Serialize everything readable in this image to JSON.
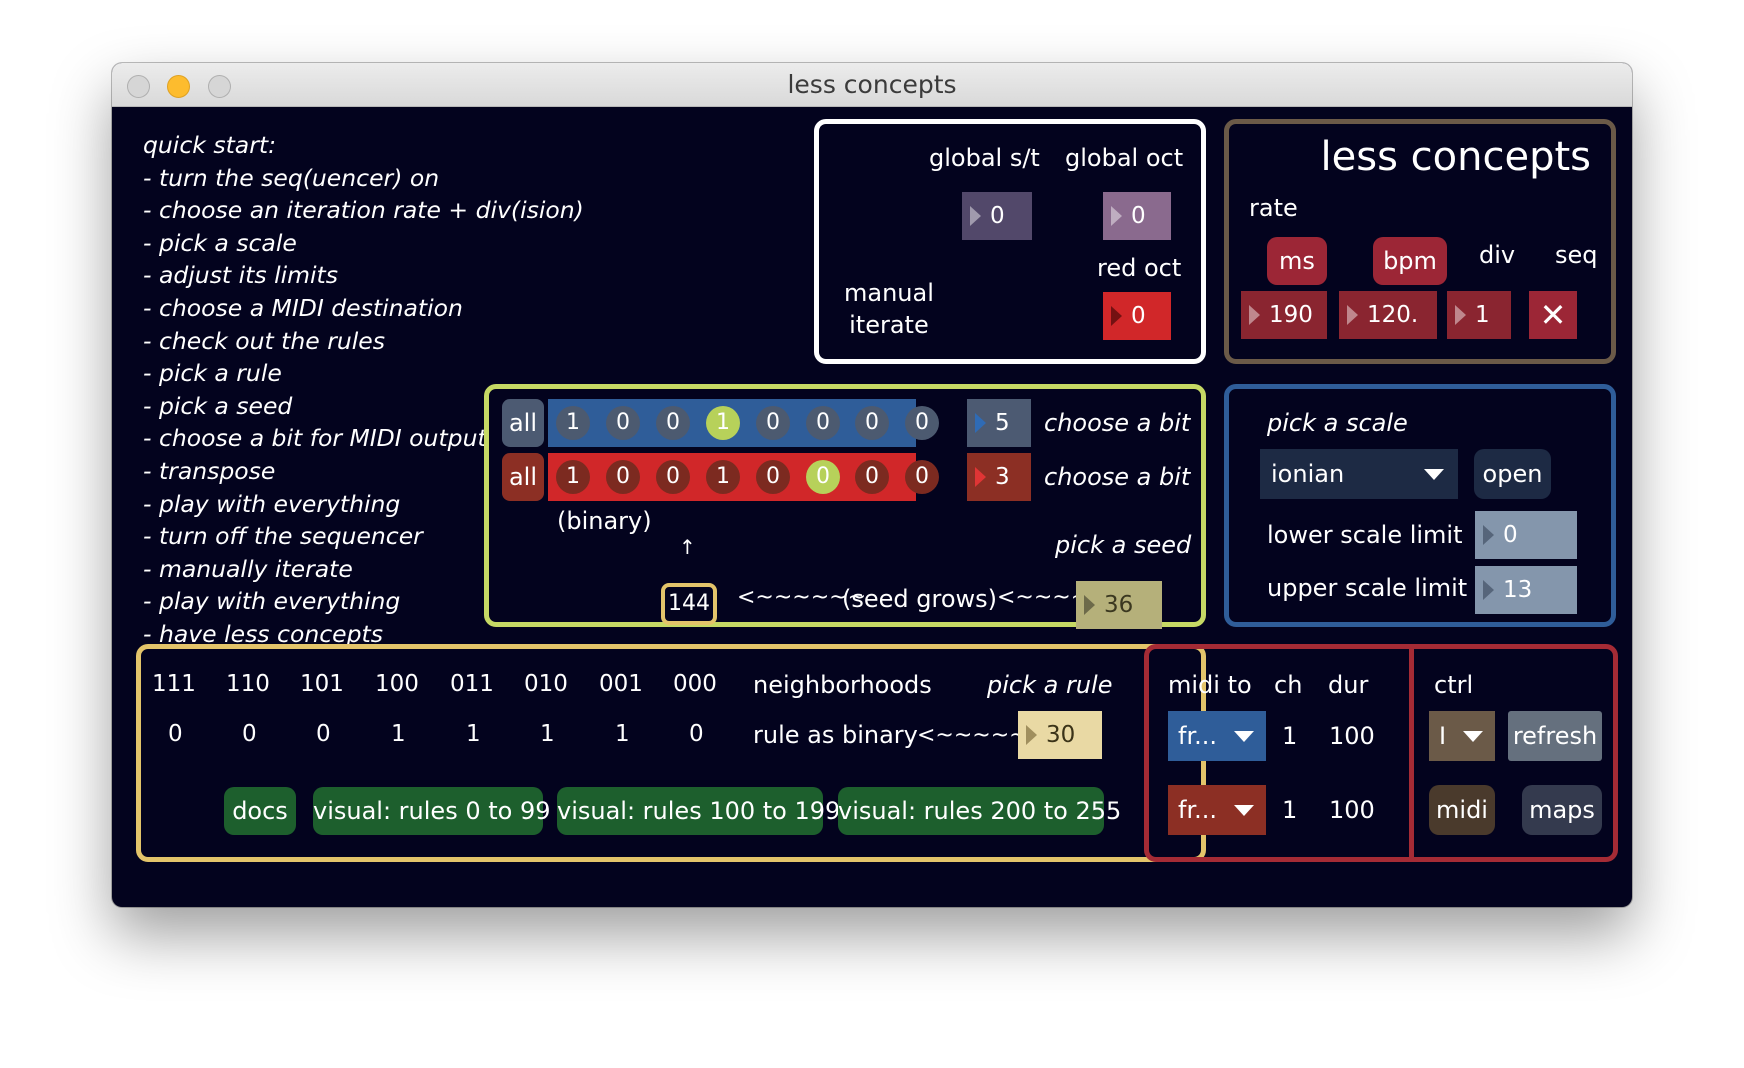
{
  "window": {
    "title": "less concepts"
  },
  "quick_start": {
    "title": "quick start:",
    "steps": [
      "- turn the seq(uencer) on",
      "- choose an iteration rate + div(ision)",
      "- pick a scale",
      "- adjust its limits",
      "- choose a MIDI destination",
      "- check out the rules",
      "- pick a rule",
      "- pick a seed",
      "- choose a bit for MIDI output",
      "- transpose",
      "- play with everything",
      "- turn off the sequencer",
      "- manually iterate",
      "- play with everything",
      "- have less concepts"
    ]
  },
  "global": {
    "st_label": "global s/t",
    "st_value": "0",
    "oct_label": "global oct",
    "oct_value": "0",
    "red_oct_label": "red oct",
    "red_oct_value": "0",
    "manual_iterate_line1": "manual",
    "manual_iterate_line2": "iterate"
  },
  "header": {
    "title": "less concepts",
    "rate_label": "rate",
    "ms_button": "ms",
    "bpm_button": "bpm",
    "div_label": "div",
    "seq_label": "seq",
    "ms_value": "190",
    "bpm_value": "120.",
    "div_value": "1",
    "seq_toggle": "✕"
  },
  "bits": {
    "all_label": "all",
    "blue_row": [
      "1",
      "0",
      "0",
      "1",
      "0",
      "0",
      "0",
      "0"
    ],
    "blue_selected_index": 3,
    "blue_value": "5",
    "red_row": [
      "1",
      "0",
      "0",
      "1",
      "0",
      "0",
      "0",
      "0"
    ],
    "red_selected_index": 5,
    "red_value": "3",
    "choose_bit_label": "choose a bit",
    "binary_label": "(binary)",
    "arrow": "↑",
    "pick_seed_label": "pick a seed",
    "seed_result": "144",
    "arrow_left_1": "<~~~~~~",
    "seed_grows_label": "(seed grows)",
    "arrow_left_2": "<~~~~~~",
    "seed_value": "36"
  },
  "scale": {
    "pick_label": "pick a scale",
    "selected": "ionian",
    "open_button": "open",
    "lower_label": "lower scale limit",
    "lower_value": "0",
    "upper_label": "upper scale limit",
    "upper_value": "13"
  },
  "rules": {
    "neighborhoods": [
      "111",
      "110",
      "101",
      "100",
      "011",
      "010",
      "001",
      "000"
    ],
    "neighborhoods_label": "neighborhoods",
    "pick_rule_label": "pick a rule",
    "binary_values": [
      "0",
      "0",
      "0",
      "1",
      "1",
      "1",
      "1",
      "0"
    ],
    "rule_as_binary_label": "rule as binary",
    "arrow_left": "<~~~~~~",
    "rule_value": "30",
    "docs_button": "docs",
    "visual_0_99": "visual: rules 0 to 99",
    "visual_100_199": "visual: rules 100 to 199",
    "visual_200_255": "visual: rules 200 to 255"
  },
  "midi": {
    "midi_to_label": "midi to",
    "ch_label": "ch",
    "dur_label": "dur",
    "row1": {
      "dest": "fr...",
      "ch": "1",
      "dur": "100"
    },
    "row2": {
      "dest": "fr...",
      "ch": "1",
      "dur": "100"
    },
    "ctrl_label": "ctrl",
    "ctrl_value": "I",
    "refresh_button": "refresh",
    "midi_button": "midi",
    "maps_button": "maps"
  },
  "colors": {
    "background": "#03031e",
    "seed_panel": "#c6d964",
    "header_panel": "#6b5a48",
    "scale_panel": "#2f5d99",
    "rules_panel": "#e3c46a",
    "midi_panel": "#a52b35",
    "blue_bits": "#2f5d99",
    "red_bits": "#d12729",
    "bit_highlight": "#b7d15a",
    "green_button": "#1d5f2d",
    "maroon_button": "#9c2636"
  }
}
